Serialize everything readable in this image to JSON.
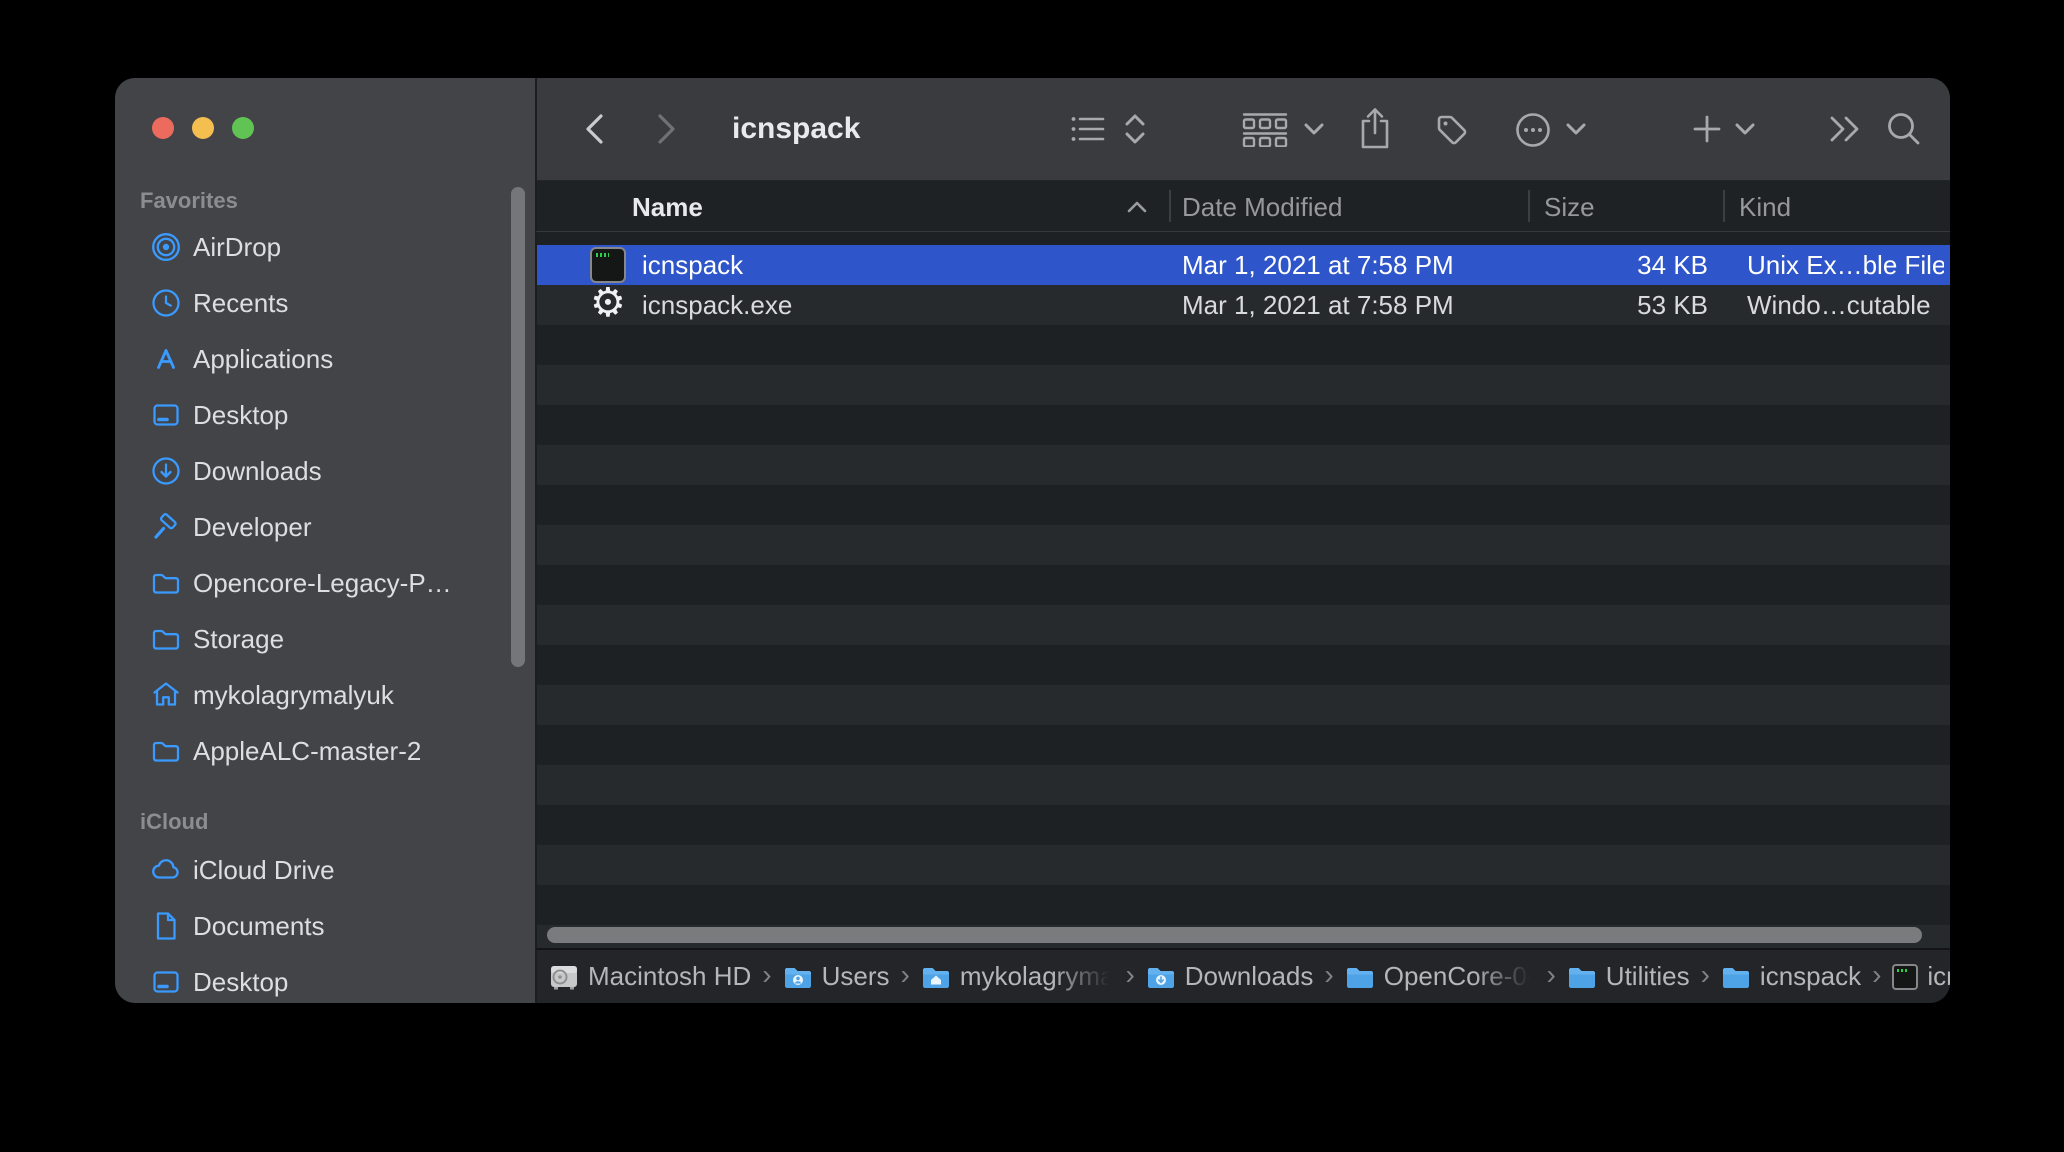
{
  "window": {
    "title": "icnspack"
  },
  "colors": {
    "selection_blue": "#2e55c9",
    "sidebar_icon_blue": "#3a9aff",
    "path_folder_blue": "#4ea3e6",
    "traffic_red": "#ed6a5e",
    "traffic_yellow": "#f4bf4f",
    "traffic_green": "#61c354"
  },
  "sidebar": {
    "sections": [
      {
        "label": "Favorites",
        "items": [
          {
            "icon": "airdrop-icon",
            "label": "AirDrop"
          },
          {
            "icon": "clock-icon",
            "label": "Recents"
          },
          {
            "icon": "appstore-icon",
            "label": "Applications"
          },
          {
            "icon": "desktop-icon",
            "label": "Desktop"
          },
          {
            "icon": "downloads-icon",
            "label": "Downloads"
          },
          {
            "icon": "hammer-icon",
            "label": "Developer"
          },
          {
            "icon": "folder-icon",
            "label": "Opencore-Legacy-P…"
          },
          {
            "icon": "folder-icon",
            "label": "Storage"
          },
          {
            "icon": "home-icon",
            "label": "mykolagrymalyuk"
          },
          {
            "icon": "folder-icon",
            "label": "AppleALC-master-2"
          }
        ]
      },
      {
        "label": "iCloud",
        "items": [
          {
            "icon": "cloud-icon",
            "label": "iCloud Drive"
          },
          {
            "icon": "document-icon",
            "label": "Documents"
          },
          {
            "icon": "desktop-icon",
            "label": "Desktop"
          }
        ]
      }
    ]
  },
  "list": {
    "columns": {
      "name": "Name",
      "date": "Date Modified",
      "size": "Size",
      "kind": "Kind"
    },
    "rows": [
      {
        "name": "icnspack",
        "date": "Mar 1, 2021 at 7:58 PM",
        "size": "34 KB",
        "kind": "Unix Ex…ble File",
        "selected": true
      },
      {
        "name": "icnspack.exe",
        "date": "Mar 1, 2021 at 7:58 PM",
        "size": "53 KB",
        "kind": "Windo…cutable",
        "selected": false
      }
    ]
  },
  "path_bar": {
    "items": [
      {
        "icon": "hdd-icon",
        "label": "Macintosh HD"
      },
      {
        "icon": "folder-users-icon",
        "label": "Users"
      },
      {
        "icon": "folder-home-icon",
        "label": "mykolagryma"
      },
      {
        "icon": "folder-downloads-icon",
        "label": "Downloads"
      },
      {
        "icon": "folder-blue-icon",
        "label": "OpenCore-0-"
      },
      {
        "icon": "folder-blue-icon",
        "label": "Utilities"
      },
      {
        "icon": "folder-blue-icon",
        "label": "icnspack"
      },
      {
        "icon": "terminal-file-icon",
        "label": "icnspack"
      }
    ]
  }
}
